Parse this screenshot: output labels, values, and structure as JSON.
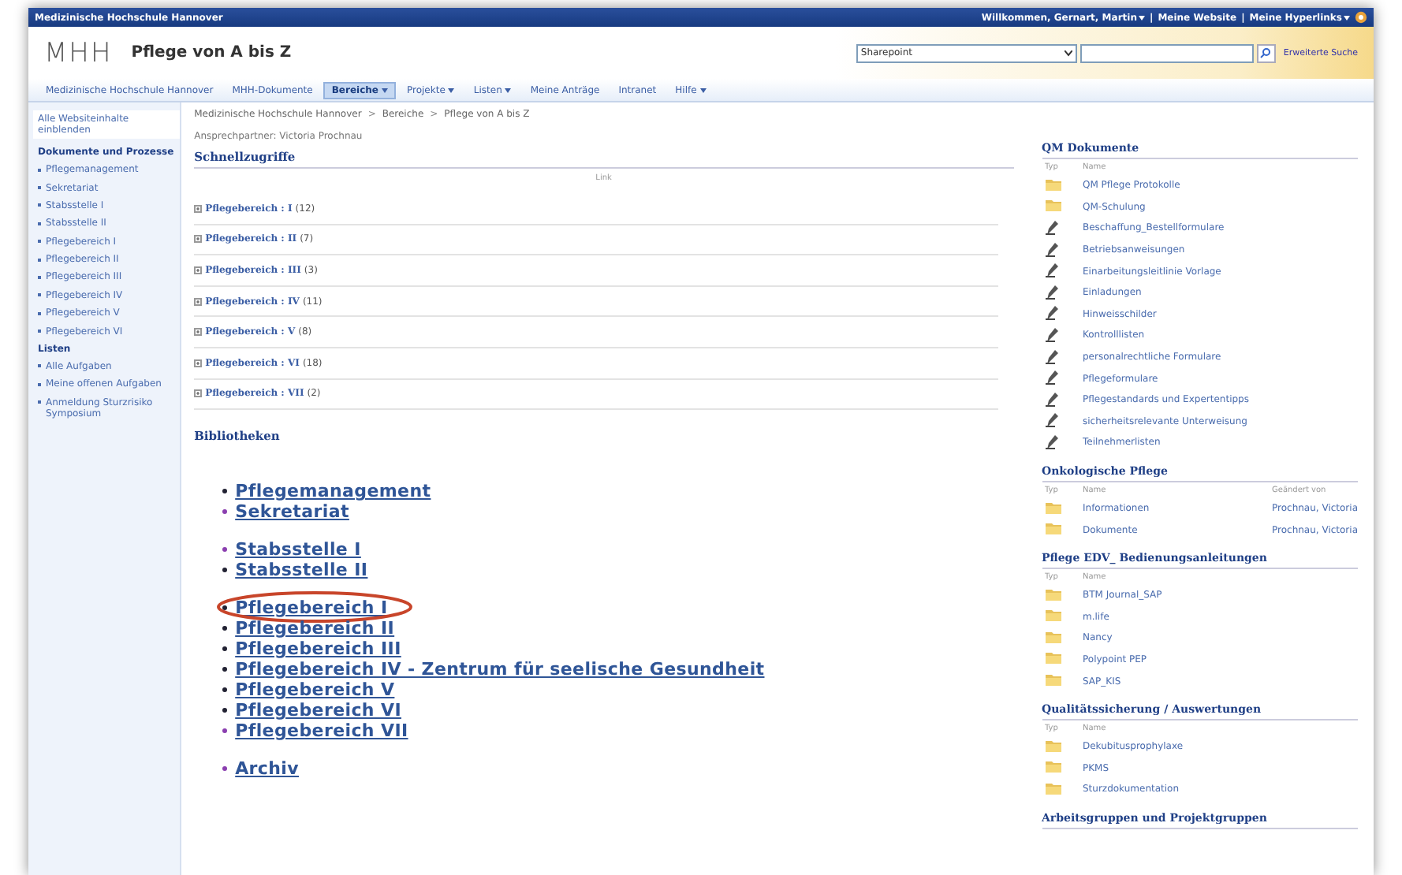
{
  "top_bar": {
    "site": "Medizinische Hochschule Hannover",
    "separator": "|",
    "links": [
      {
        "label": "Willkommen, Gernart, Martin",
        "menu": true
      },
      {
        "label": "Meine Website",
        "menu": false
      },
      {
        "label": "Meine Hyperlinks",
        "menu": true
      }
    ]
  },
  "header": {
    "logo": "MHH",
    "title": "Pflege von A bis Z",
    "scope": "Sharepoint",
    "advanced_search": "Erweiterte Suche"
  },
  "nav": [
    {
      "label": "Medizinische Hochschule Hannover",
      "menu": false,
      "selected": false
    },
    {
      "label": "MHH-Dokumente",
      "menu": false,
      "selected": false
    },
    {
      "label": "Bereiche",
      "menu": true,
      "selected": true
    },
    {
      "label": "Projekte",
      "menu": true,
      "selected": false
    },
    {
      "label": "Listen",
      "menu": true,
      "selected": false
    },
    {
      "label": "Meine Anträge",
      "menu": false,
      "selected": false
    },
    {
      "label": "Intranet",
      "menu": false,
      "selected": false
    },
    {
      "label": "Hilfe",
      "menu": true,
      "selected": false
    }
  ],
  "sidebar": {
    "all_content": "Alle Websiteinhalte einblenden",
    "groups": [
      {
        "title": "Dokumente und Prozesse",
        "items": [
          "Pflegemanagement",
          "Sekretariat",
          "Stabsstelle I",
          "Stabsstelle II",
          "Pflegebereich I",
          "Pflegebereich II",
          "Pflegebereich III",
          "Pflegebereich IV",
          "Pflegebereich V",
          "Pflegebereich VI"
        ]
      },
      {
        "title": "Listen",
        "items": [
          "Alle Aufgaben",
          "Meine offenen Aufgaben",
          "Anmeldung Sturzrisiko Symposium"
        ]
      }
    ]
  },
  "breadcrumb": {
    "separator": ">",
    "items": [
      "Medizinische Hochschule Hannover",
      "Bereiche",
      "Pflege von A bis Z"
    ]
  },
  "contact": "Ansprechpartner: Victoria Prochnau",
  "quick_access": {
    "title": "Schnellzugriffe",
    "column": "Link",
    "rows": [
      {
        "label": "Pflegebereich : I",
        "count": "(12)"
      },
      {
        "label": "Pflegebereich : II",
        "count": "(7)"
      },
      {
        "label": "Pflegebereich : III",
        "count": "(3)"
      },
      {
        "label": "Pflegebereich : IV",
        "count": "(11)"
      },
      {
        "label": "Pflegebereich : V",
        "count": "(8)"
      },
      {
        "label": "Pflegebereich : VI",
        "count": "(18)"
      },
      {
        "label": "Pflegebereich : VII",
        "count": "(2)"
      }
    ]
  },
  "libraries": {
    "title": "Bibliotheken",
    "groups": [
      [
        {
          "label": "Pflegemanagement",
          "visited": false,
          "circled": false
        },
        {
          "label": "Sekretariat",
          "visited": true,
          "circled": false
        }
      ],
      [
        {
          "label": "Stabsstelle I",
          "visited": true,
          "circled": false
        },
        {
          "label": "Stabsstelle II",
          "visited": false,
          "circled": false
        }
      ],
      [
        {
          "label": "Pflegebereich I",
          "visited": false,
          "circled": true
        },
        {
          "label": "Pflegebereich II",
          "visited": false,
          "circled": false
        },
        {
          "label": "Pflegebereich III",
          "visited": false,
          "circled": false
        },
        {
          "label": "Pflegebereich IV - Zentrum für seelische Gesundheit",
          "visited": false,
          "circled": false
        },
        {
          "label": "Pflegebereich V",
          "visited": false,
          "circled": false
        },
        {
          "label": "Pflegebereich VI",
          "visited": false,
          "circled": false
        },
        {
          "label": "Pflegebereich VII",
          "visited": true,
          "circled": false
        }
      ],
      [
        {
          "label": "Archiv",
          "visited": true,
          "circled": false
        }
      ]
    ]
  },
  "panels": [
    {
      "title": "QM Dokumente",
      "columns": [
        "Typ",
        "Name"
      ],
      "items": [
        {
          "kind": "folder",
          "name": "QM Pflege Protokolle"
        },
        {
          "kind": "folder",
          "name": "QM-Schulung"
        },
        {
          "kind": "document",
          "name": "Beschaffung_Bestellformulare"
        },
        {
          "kind": "document",
          "name": "Betriebsanweisungen"
        },
        {
          "kind": "document",
          "name": "Einarbeitungsleitlinie Vorlage"
        },
        {
          "kind": "document",
          "name": "Einladungen"
        },
        {
          "kind": "document",
          "name": "Hinweisschilder"
        },
        {
          "kind": "document",
          "name": "Kontrolllisten"
        },
        {
          "kind": "document",
          "name": "personalrechtliche Formulare"
        },
        {
          "kind": "document",
          "name": "Pflegeformulare"
        },
        {
          "kind": "document",
          "name": "Pflegestandards und Expertentipps"
        },
        {
          "kind": "document",
          "name": "sicherheitsrelevante Unterweisung"
        },
        {
          "kind": "document",
          "name": "Teilnehmerlisten"
        }
      ]
    },
    {
      "title": "Onkologische Pflege",
      "columns": [
        "Typ",
        "Name",
        "Geändert von"
      ],
      "items": [
        {
          "kind": "folder",
          "name": "Informationen",
          "modified_by": "Prochnau, Victoria"
        },
        {
          "kind": "folder",
          "name": "Dokumente",
          "modified_by": "Prochnau, Victoria"
        }
      ]
    },
    {
      "title": "Pflege EDV_ Bedienungsanleitungen",
      "columns": [
        "Typ",
        "Name"
      ],
      "items": [
        {
          "kind": "folder",
          "name": "BTM Journal_SAP"
        },
        {
          "kind": "folder",
          "name": "m.life"
        },
        {
          "kind": "folder",
          "name": "Nancy"
        },
        {
          "kind": "folder",
          "name": "Polypoint PEP"
        },
        {
          "kind": "folder",
          "name": "SAP_KIS"
        }
      ]
    },
    {
      "title": "Qualitätssicherung / Auswertungen",
      "columns": [
        "Typ",
        "Name"
      ],
      "items": [
        {
          "kind": "folder",
          "name": "Dekubitusprophylaxe"
        },
        {
          "kind": "folder",
          "name": "PKMS"
        },
        {
          "kind": "folder",
          "name": "Sturzdokumentation"
        }
      ]
    },
    {
      "title": "Arbeitsgruppen und Projektgruppen"
    }
  ]
}
